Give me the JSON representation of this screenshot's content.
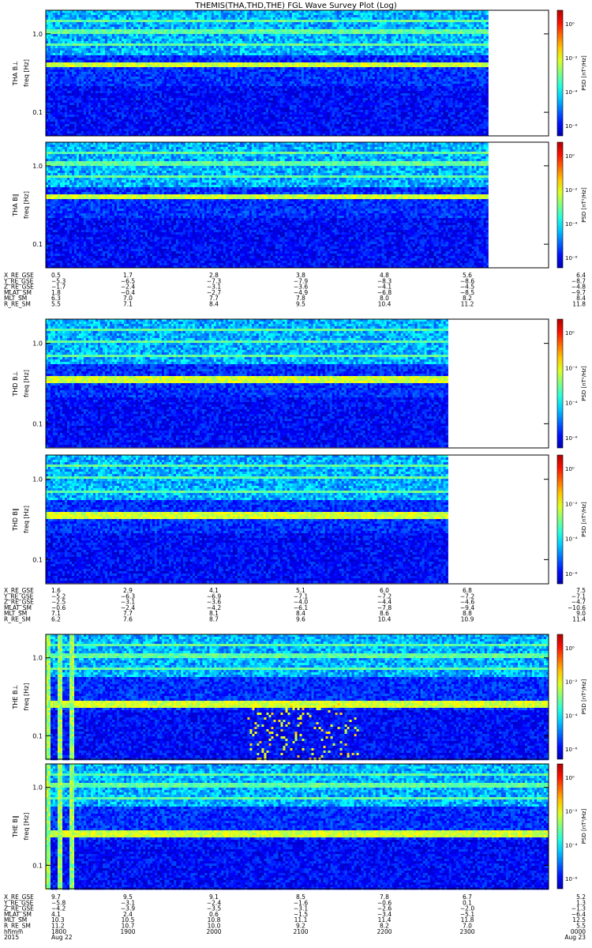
{
  "title": "THEMIS(THA,THD,THE) FGL Wave Survey Plot (Log)",
  "colorbar_ticks": [
    "10⁰",
    "10⁻²",
    "10⁻⁴",
    "10⁻⁶"
  ],
  "colorbar_label": "PSD [nT²/Hz]",
  "freq_axis_label": "freq [Hz]",
  "freq_ticks": [
    "1.0",
    "0.1"
  ],
  "chart_data": [
    {
      "type": "heatmap",
      "probe": "THA",
      "component": "B⊥",
      "ylabel": "THA B⊥",
      "scale": "log",
      "ylim_hz": [
        0.05,
        2.0
      ],
      "data_end_fraction": 0.88,
      "bright_band_hz": 0.4
    },
    {
      "type": "heatmap",
      "probe": "THA",
      "component": "B∥",
      "ylabel": "THA B∥",
      "scale": "log",
      "ylim_hz": [
        0.05,
        2.0
      ],
      "data_end_fraction": 0.88,
      "bright_band_hz": 0.4
    },
    {
      "type": "heatmap",
      "probe": "THD",
      "component": "B⊥",
      "ylabel": "THD B⊥",
      "scale": "log",
      "ylim_hz": [
        0.05,
        2.0
      ],
      "data_end_fraction": 0.8,
      "bright_band_hz": 0.35
    },
    {
      "type": "heatmap",
      "probe": "THD",
      "component": "B∥",
      "ylabel": "THD B∥",
      "scale": "log",
      "ylim_hz": [
        0.05,
        2.0
      ],
      "data_end_fraction": 0.8,
      "bright_band_hz": 0.35
    },
    {
      "type": "heatmap",
      "probe": "THE",
      "component": "B⊥",
      "ylabel": "THE B⊥",
      "scale": "log",
      "ylim_hz": [
        0.05,
        2.0
      ],
      "data_end_fraction": 1.0,
      "bright_band_hz": 0.25
    },
    {
      "type": "heatmap",
      "probe": "THE",
      "component": "B∥",
      "ylabel": "THE B∥",
      "scale": "log",
      "ylim_hz": [
        0.05,
        2.0
      ],
      "data_end_fraction": 1.0,
      "bright_band_hz": 0.25
    }
  ],
  "ephemeris_tables": [
    {
      "rows": [
        {
          "label": "X_RE_GSE",
          "values": [
            "0.5",
            "1.7",
            "2.8",
            "3.8",
            "4.8",
            "5.6",
            "6.4"
          ]
        },
        {
          "label": "Y_RE_GSE",
          "values": [
            "−5.3",
            "−6.5",
            "−7.3",
            "−7.9",
            "−8.3",
            "−8.6",
            "−8.7"
          ]
        },
        {
          "label": "Z_RE_GSE",
          "values": [
            "−1.7",
            "−2.4",
            "−3.1",
            "−3.6",
            "−4.1",
            "−4.5",
            "−4.8"
          ]
        },
        {
          "label": "MLAT_SM",
          "values": [
            "1.8",
            "−0.4",
            "−2.7",
            "−4.9",
            "−6.8",
            "−8.5",
            "−9.7"
          ]
        },
        {
          "label": "MLT_SM",
          "values": [
            "6.3",
            "7.0",
            "7.7",
            "7.8",
            "8.0",
            "8.2",
            "8.4"
          ]
        },
        {
          "label": "R_RE_SM",
          "values": [
            "5.5",
            "7.1",
            "8.4",
            "9.5",
            "10.4",
            "11.2",
            "11.8"
          ]
        }
      ]
    },
    {
      "rows": [
        {
          "label": "X_RE_GSE",
          "values": [
            "1.6",
            "2.9",
            "4.1",
            "5.1",
            "6.0",
            "6.8",
            "7.5"
          ]
        },
        {
          "label": "Y_RE_GSE",
          "values": [
            "−5.2",
            "−6.3",
            "−6.9",
            "−7.1",
            "−7.2",
            "−7.2",
            "−7.1"
          ]
        },
        {
          "label": "Z_RE_GSE",
          "values": [
            "−2.5",
            "−3.1",
            "−3.6",
            "−4.0",
            "−4.4",
            "−4.6",
            "−4.7"
          ]
        },
        {
          "label": "MLAT_SM",
          "values": [
            "−0.6",
            "−2.4",
            "−4.2",
            "−6.1",
            "−7.8",
            "−9.4",
            "−10.6"
          ]
        },
        {
          "label": "MLT_SM",
          "values": [
            "7.1",
            "7.7",
            "8.1",
            "8.4",
            "8.6",
            "8.8",
            "9.0"
          ]
        },
        {
          "label": "R_RE_SM",
          "values": [
            "6.2",
            "7.6",
            "8.7",
            "9.6",
            "10.4",
            "10.9",
            "11.4"
          ]
        }
      ]
    },
    {
      "rows": [
        {
          "label": "X_RE_GSE",
          "values": [
            "9.7",
            "9.5",
            "9.1",
            "8.5",
            "7.8",
            "6.7",
            "5.2"
          ]
        },
        {
          "label": "Y_RE_GSE",
          "values": [
            "−5.8",
            "−3.1",
            "−2.4",
            "−1.6",
            "−0.6",
            "0.1",
            "1.3"
          ]
        },
        {
          "label": "Z_RE_GSE",
          "values": [
            "−4.2",
            "−3.9",
            "−3.5",
            "−3.1",
            "−2.6",
            "−2.0",
            "−1.3"
          ]
        },
        {
          "label": "MLAT_SM",
          "values": [
            "4.1",
            "2.4",
            "0.6",
            "−1.5",
            "−3.4",
            "−5.1",
            "−6.4"
          ]
        },
        {
          "label": "MLT_SM",
          "values": [
            "10.3",
            "10.5",
            "10.8",
            "11.1",
            "11.4",
            "11.8",
            "12.5"
          ]
        },
        {
          "label": "R_RE_SM",
          "values": [
            "11.2",
            "10.7",
            "10.0",
            "9.2",
            "8.2",
            "7.0",
            "5.5"
          ]
        },
        {
          "label": "hhmm",
          "values": [
            "1800",
            "1900",
            "2000",
            "2100",
            "2200",
            "2300",
            "0000"
          ]
        },
        {
          "label": "2015",
          "values": [
            "Aug 22",
            "",
            "",
            "",
            "",
            "",
            "Aug 23"
          ]
        }
      ]
    }
  ]
}
